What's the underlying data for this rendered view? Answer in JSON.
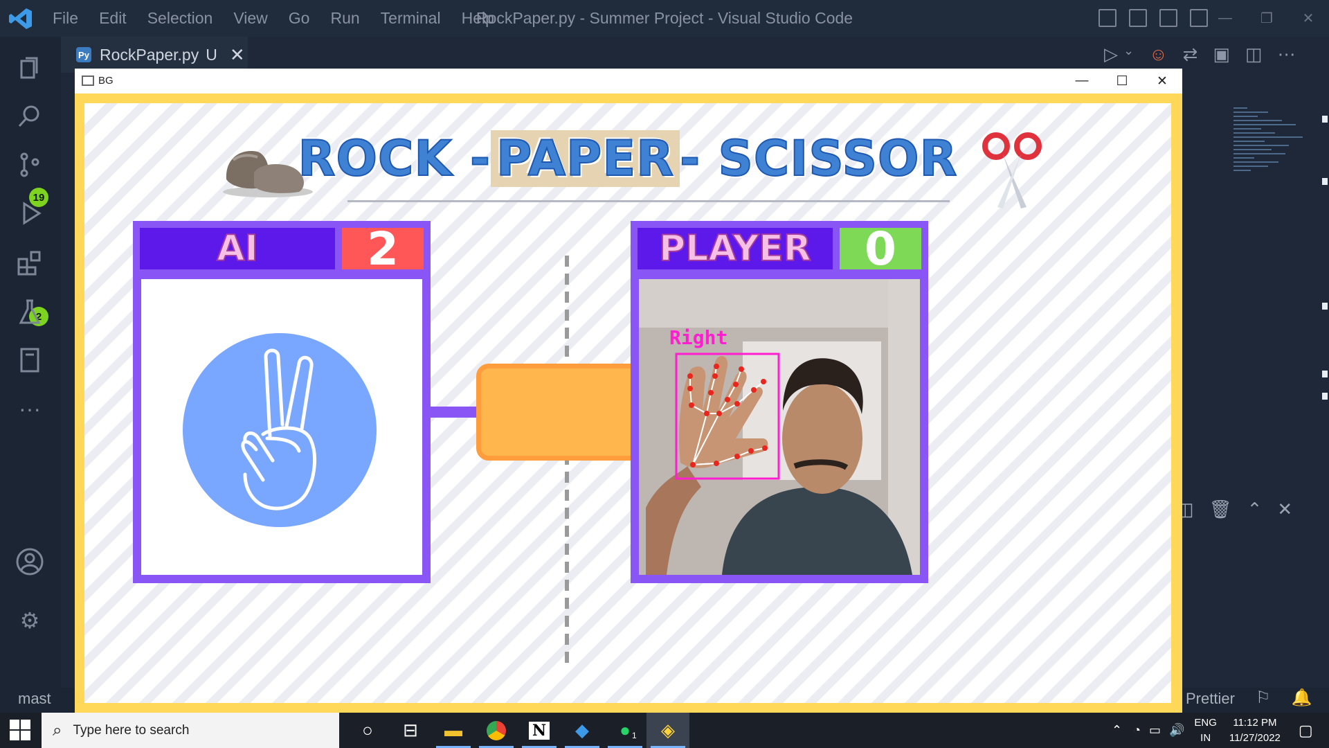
{
  "vscode": {
    "menu": [
      "File",
      "Edit",
      "Selection",
      "View",
      "Go",
      "Run",
      "Terminal",
      "Help"
    ],
    "window_title": "RockPaper.py - Summer Project - Visual Studio Code",
    "tab": {
      "name": "RockPaper.py",
      "status": "U"
    },
    "badges": {
      "source_control": "19",
      "extensions": "2"
    },
    "status": {
      "branch": "mast",
      "prettier": "Prettier"
    }
  },
  "game_window": {
    "title": "BG",
    "heading": {
      "left": "ROCK - ",
      "middle": "PAPER",
      "right": " - SCISSOR"
    },
    "ai": {
      "label": "AI",
      "score": "2",
      "move": "scissor"
    },
    "player": {
      "label": "PLAYER",
      "score": "0",
      "hand_label": "Right"
    },
    "colors": {
      "frame": "#ffd85a",
      "panel": "#8a55f5",
      "header": "#5d18ea",
      "ai_score": "#ff5757",
      "player_score": "#7ed957",
      "result": "#ffb74d"
    }
  },
  "taskbar": {
    "search_placeholder": "Type here to search",
    "lang_top": "ENG",
    "lang_bottom": "IN",
    "time": "11:12 PM",
    "date": "11/27/2022",
    "whatsapp_badge": "1"
  }
}
